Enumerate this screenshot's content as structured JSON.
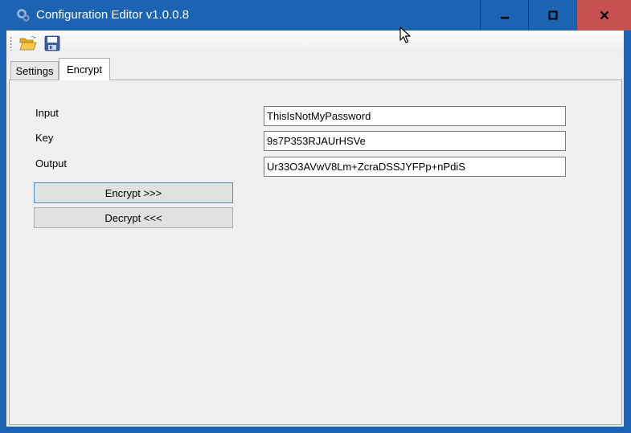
{
  "window": {
    "title": "Configuration Editor v1.0.0.8",
    "colors": {
      "titlebar": "#1c63b3",
      "close_button": "#c75050",
      "client_background": "#f0f0f0"
    }
  },
  "toolbar": {
    "buttons": [
      {
        "name": "open",
        "icon": "folder-open-icon"
      },
      {
        "name": "save",
        "icon": "floppy-disk-icon"
      }
    ]
  },
  "tabs": [
    {
      "label": "Settings",
      "selected": false
    },
    {
      "label": "Encrypt",
      "selected": true
    }
  ],
  "encrypt_panel": {
    "input_label": "Input",
    "key_label": "Key",
    "output_label": "Output",
    "input_value": "ThisIsNotMyPassword",
    "key_value": "9s7P353RJAUrHSVe",
    "output_value": "Ur33O3AVwV8Lm+ZcraDSSJYFPp+nPdiS",
    "encrypt_button": "Encrypt >>>",
    "decrypt_button": "Decrypt <<<"
  }
}
